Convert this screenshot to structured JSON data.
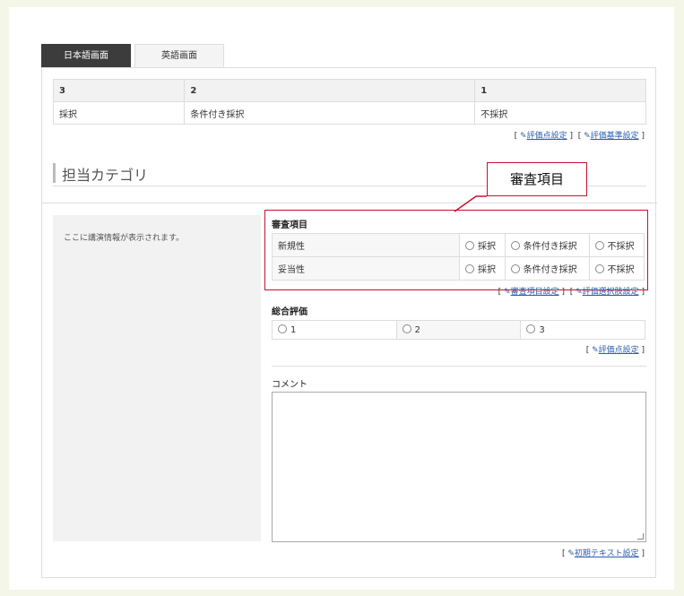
{
  "tabs": {
    "active": "日本語画面",
    "inactive": "英語画面"
  },
  "score_table": {
    "headers": [
      "3",
      "2",
      "1"
    ],
    "row": [
      "採択",
      "条件付き採択",
      "不採択"
    ]
  },
  "score_links": {
    "eval_points": "評価点設定",
    "eval_criteria": "評価基準設定"
  },
  "category": {
    "title": "担当カテゴリ"
  },
  "info_box": {
    "text": "ここに講演情報が表示されます。"
  },
  "callout": {
    "label": "審査項目"
  },
  "review": {
    "heading": "審査項目",
    "items": [
      {
        "label": "新規性",
        "options": [
          "採択",
          "条件付き採択",
          "不採択"
        ]
      },
      {
        "label": "妥当性",
        "options": [
          "採択",
          "条件付き採択",
          "不採択"
        ]
      }
    ],
    "link_items": "審査項目設定",
    "link_options": "評価選択肢設定"
  },
  "overall": {
    "heading": "総合評価",
    "options": [
      "1",
      "2",
      "3"
    ],
    "link": "評価点設定"
  },
  "comment": {
    "label": "コメント",
    "link": "初期テキスト設定"
  },
  "colors": {
    "highlight": "#c8102e",
    "link": "#2a5db0",
    "tab_active": "#3c3c3c"
  }
}
